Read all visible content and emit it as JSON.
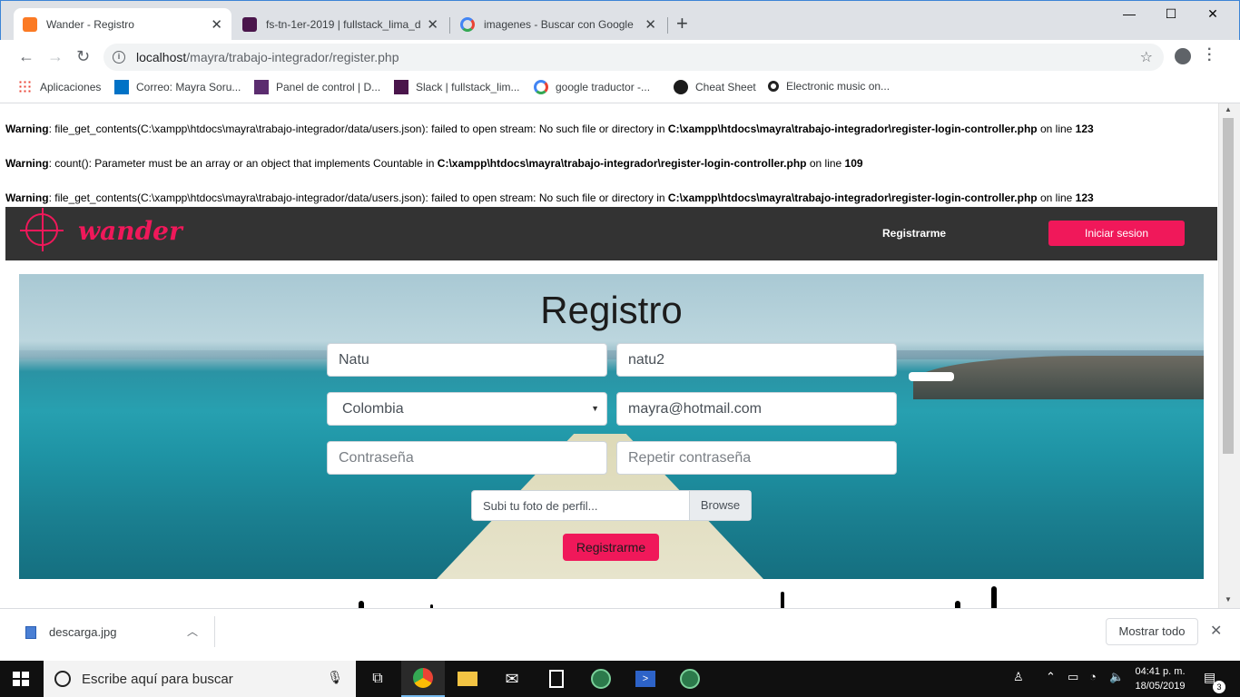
{
  "browser": {
    "tabs": [
      {
        "label": "Wander - Registro",
        "icon": "xampp-icon",
        "active": true
      },
      {
        "label": "fs-tn-1er-2019 | fullstack_lima_di",
        "icon": "slack-icon",
        "active": false
      },
      {
        "label": "imagenes - Buscar con Google",
        "icon": "google-icon",
        "active": false
      }
    ],
    "address": {
      "host": "localhost",
      "path": "/mayra/trabajo-integrador/register.php"
    },
    "bookmarks": [
      {
        "label": "Aplicaciones"
      },
      {
        "label": "Correo: Mayra Soru..."
      },
      {
        "label": "Panel de control | D..."
      },
      {
        "label": "Slack | fullstack_lim..."
      },
      {
        "label": "google traductor -..."
      },
      {
        "label": "Cheat Sheet"
      },
      {
        "label": "Electronic music on..."
      }
    ]
  },
  "warnings": [
    {
      "prefix": "Warning",
      "message": ": file_get_contents(C:\\xampp\\htdocs\\mayra\\trabajo-integrador/data/users.json): failed to open stream: No such file or directory in ",
      "file": "C:\\xampp\\htdocs\\mayra\\trabajo-integrador\\register-login-controller.php",
      "online": " on line ",
      "line": "123"
    },
    {
      "prefix": "Warning",
      "message": ": count(): Parameter must be an array or an object that implements Countable in ",
      "file": "C:\\xampp\\htdocs\\mayra\\trabajo-integrador\\register-login-controller.php",
      "online": " on line ",
      "line": "109"
    },
    {
      "prefix": "Warning",
      "message": ": file_get_contents(C:\\xampp\\htdocs\\mayra\\trabajo-integrador/data/users.json): failed to open stream: No such file or directory in ",
      "file": "C:\\xampp\\htdocs\\mayra\\trabajo-integrador\\register-login-controller.php",
      "online": " on line ",
      "line": "123"
    }
  ],
  "site": {
    "logo_text": "wander",
    "nav_link": "Registrarme",
    "login_button": "Iniciar sesion",
    "accent_color": "#f0185a",
    "form": {
      "title": "Registro",
      "name_value": "Natu",
      "username_value": "natu2",
      "country_value": "Colombia",
      "email_value": "mayra@hotmail.com",
      "password_placeholder": "Contraseña",
      "repeat_password_placeholder": "Repetir contraseña",
      "file_placeholder": "Subi tu foto de perfil...",
      "browse_label": "Browse",
      "submit_label": "Registrarme"
    }
  },
  "downloads": {
    "file_name": "descarga.jpg",
    "show_all": "Mostrar todo"
  },
  "taskbar": {
    "search_placeholder": "Escribe aquí para buscar",
    "time": "04:41 p. m.",
    "date": "18/05/2019",
    "notifications": "3"
  }
}
